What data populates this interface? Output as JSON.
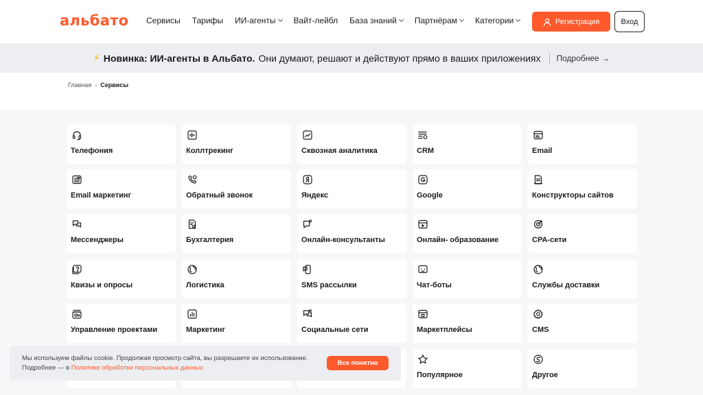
{
  "header": {
    "logo": "альбато",
    "nav": [
      {
        "label": "Сервисы",
        "dropdown": false
      },
      {
        "label": "Тарифы",
        "dropdown": false
      },
      {
        "label": "ИИ-агенты",
        "dropdown": true
      },
      {
        "label": "Вайт-лейбл",
        "dropdown": false
      },
      {
        "label": "База знаний",
        "dropdown": true
      },
      {
        "label": "Партнёрам",
        "dropdown": true
      },
      {
        "label": "Категории",
        "dropdown": true
      }
    ],
    "register_label": "Регистрация",
    "login_label": "Вход"
  },
  "announcement": {
    "icon": "lightning-icon",
    "bold": "Новинка: ИИ-агенты в Альбато.",
    "text": "Они думают, решают и действуют прямо в ваших приложениях",
    "more": "Подробнее →"
  },
  "breadcrumb": {
    "home": "Главная",
    "current": "Сервисы"
  },
  "categories": [
    {
      "label": "Телефония",
      "icon": "headset-icon"
    },
    {
      "label": "Коллтрекинг",
      "icon": "soundwave-icon"
    },
    {
      "label": "Сквозная аналитика",
      "icon": "chart-line-icon"
    },
    {
      "label": "CRM",
      "icon": "list-settings-icon"
    },
    {
      "label": "Email",
      "icon": "email-icon"
    },
    {
      "label": "Email маркетинг",
      "icon": "email-marketing-icon"
    },
    {
      "label": "Обратный звонок",
      "icon": "phone-callback-icon"
    },
    {
      "label": "Яндекс",
      "icon": "yandex-icon"
    },
    {
      "label": "Google",
      "icon": "google-icon"
    },
    {
      "label": "Конструкторы сайтов",
      "icon": "document-icon"
    },
    {
      "label": "Мессенджеры",
      "icon": "chat-bubbles-icon"
    },
    {
      "label": "Бухгалтерия",
      "icon": "accounting-icon"
    },
    {
      "label": "Онлайн-консультанты",
      "icon": "chat-dot-icon"
    },
    {
      "label": "Онлайн- образование",
      "icon": "video-lesson-icon"
    },
    {
      "label": "CPA-сети",
      "icon": "target-icon"
    },
    {
      "label": "Квизы и опросы",
      "icon": "question-icon"
    },
    {
      "label": "Логистика",
      "icon": "globe-icon"
    },
    {
      "label": "SMS рассылки",
      "icon": "sms-icon"
    },
    {
      "label": "Чат-боты",
      "icon": "bot-icon"
    },
    {
      "label": "Службы доставки",
      "icon": "delivery-globe-icon"
    },
    {
      "label": "Управление проектами",
      "icon": "projects-icon"
    },
    {
      "label": "Маркетинг",
      "icon": "bar-chart-icon"
    },
    {
      "label": "Социальные сети",
      "icon": "social-chat-icon"
    },
    {
      "label": "Маркетплейсы",
      "icon": "marketplace-icon"
    },
    {
      "label": "CMS",
      "icon": "gear-icon"
    },
    {
      "label": "",
      "icon": ""
    },
    {
      "label": "",
      "icon": ""
    },
    {
      "label": "",
      "icon": ""
    },
    {
      "label": "Популярное",
      "icon": "star-icon"
    },
    {
      "label": "Другое",
      "icon": "other-icon"
    }
  ],
  "cookie": {
    "line1": "Мы используем файлы cookie. Продолжая просмотр сайта, вы разрешаете их использование.",
    "line2_prefix": "Подробнее — в",
    "link": "Политике обработки персональных данных",
    "accept": "Все понятно"
  },
  "colors": {
    "accent": "#ff5a2c",
    "banner_bg": "#eceef1",
    "grid_bg": "#f6f7f9"
  }
}
